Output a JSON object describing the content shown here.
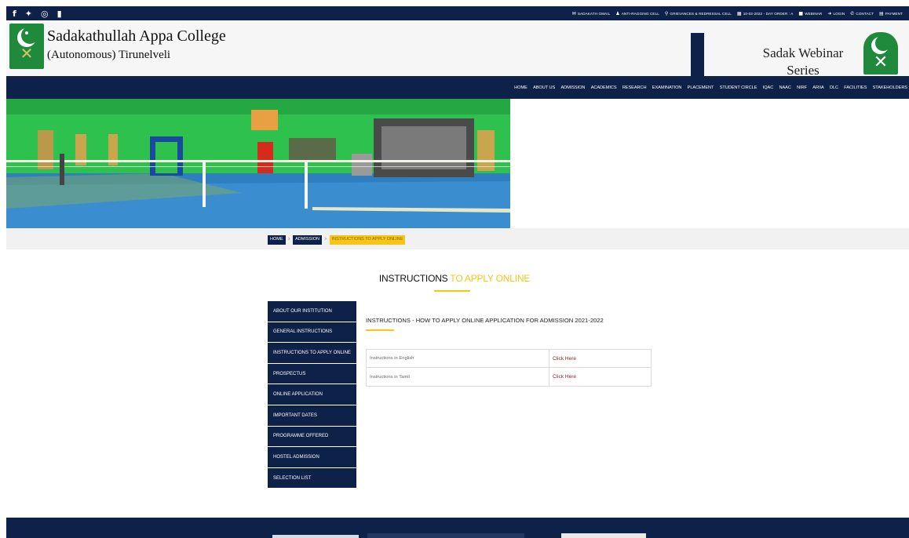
{
  "topbar": {
    "social_icons": [
      "facebook-icon",
      "twitter-icon",
      "instagram-icon",
      "youtube-icon"
    ],
    "links": [
      {
        "label": "SADAKATH GMAIL",
        "icon": "mail-icon"
      },
      {
        "label": "ANTI-RAGGING CELL",
        "icon": "user-icon"
      },
      {
        "label": "GRIEVANCES & REDRESSAL CELL",
        "icon": "location-icon"
      },
      {
        "label": "10-03-2022 - DAY ORDER : A",
        "icon": "calendar-icon"
      },
      {
        "label": "WEBINAR",
        "icon": "video-icon"
      },
      {
        "label": "LOGIN",
        "icon": "login-icon"
      },
      {
        "label": "CONTACT",
        "icon": "phone-icon"
      },
      {
        "label": "PAYMENT",
        "icon": "payment-icon"
      }
    ]
  },
  "header": {
    "college_name": "Sadakathullah Appa College",
    "college_sub": "(Autonomous) Tirunelveli",
    "webinar_line1": "Sadak Webinar",
    "webinar_line2": "Series"
  },
  "nav": [
    "HOME",
    "ABOUT US",
    "ADMISSION",
    "ACADEMICS",
    "RESEARCH",
    "EXAMINATION",
    "PLACEMENT",
    "STUDENT CIRCLE",
    "IQAC",
    "NAAC",
    "NIRF",
    "ARIIA",
    "DLC",
    "FACILITIES",
    "STAKEHOLDERS"
  ],
  "breadcrumb": [
    "HOME",
    "ADMISSION",
    "INSTRUCTIONS TO APPLY ONLINE"
  ],
  "page_title": {
    "part1": "INSTRUCTIONS ",
    "part2": "TO APPLY ONLINE"
  },
  "sidebar": [
    "ABOUT OUR INSTITUTION",
    "GENERAL INSTRUCTIONS",
    "INSTRUCTIONS TO APPLY ONLINE",
    "PROSPECTUS",
    "ONLINE APPLICATION",
    "IMPORTANT DATES",
    "PROGRAMME OFFERED",
    "HOSTEL ADMISSION",
    "SELECTION LIST"
  ],
  "content": {
    "title": "INSTRUCTIONS - HOW TO APPLY ONLINE APPLICATION FOR ADMISSION 2021-2022",
    "rows": [
      {
        "label": "Instructions in English",
        "link": "Click Here"
      },
      {
        "label": "Instructions in Tamil",
        "link": "Click Here"
      }
    ]
  },
  "colors": {
    "navy": "#0e2148",
    "accent": "#f5c518",
    "link": "#8b1a1a",
    "green": "#1f8a3c"
  }
}
